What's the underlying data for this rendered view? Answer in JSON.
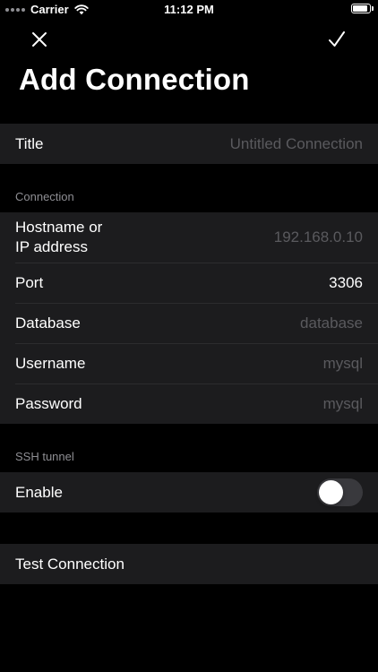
{
  "status_bar": {
    "carrier": "Carrier",
    "time": "11:12 PM",
    "battery_level": 0.95
  },
  "nav": {
    "close_icon": "close-icon",
    "done_icon": "checkmark-icon",
    "title": "Add Connection"
  },
  "title_section": {
    "label": "Title",
    "placeholder": "Untitled Connection"
  },
  "connection_section": {
    "header": "Connection",
    "hostname": {
      "label_line1": "Hostname or",
      "label_line2": "IP address",
      "placeholder": "192.168.0.10"
    },
    "port": {
      "label": "Port",
      "value": "3306"
    },
    "database": {
      "label": "Database",
      "placeholder": "database"
    },
    "username": {
      "label": "Username",
      "placeholder": "mysql"
    },
    "password": {
      "label": "Password",
      "placeholder": "mysql"
    }
  },
  "ssh_section": {
    "header": "SSH tunnel",
    "enable": {
      "label": "Enable",
      "on": false
    }
  },
  "actions": {
    "test_connection": "Test Connection"
  },
  "colors": {
    "background": "#000000",
    "cell": "#1c1c1e",
    "separator": "#2c2c2e",
    "secondary_text": "#8e8e93",
    "placeholder": "#5a5a5e",
    "toggle_off": "#39393d"
  }
}
